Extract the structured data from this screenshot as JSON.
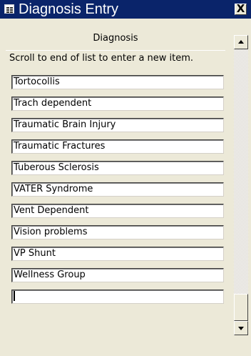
{
  "window": {
    "title": "Diagnosis Entry",
    "close_glyph": "X",
    "icon": "form-icon"
  },
  "form": {
    "column_header": "Diagnosis",
    "hint": "Scroll to end of list to enter a new item.",
    "items": [
      "Tortocollis",
      "Trach dependent",
      "Traumatic Brain Injury",
      "Traumatic Fractures",
      "Tuberous Sclerosis",
      "VATER Syndrome",
      "Vent Dependent",
      "Vision problems",
      "VP Shunt",
      "Wellness Group"
    ],
    "new_item_value": ""
  },
  "scrollbar": {
    "up_icon": "arrow-up-icon",
    "down_icon": "arrow-down-icon"
  },
  "colors": {
    "titlebar": "#0a246a",
    "window_bg": "#ece9d8"
  }
}
